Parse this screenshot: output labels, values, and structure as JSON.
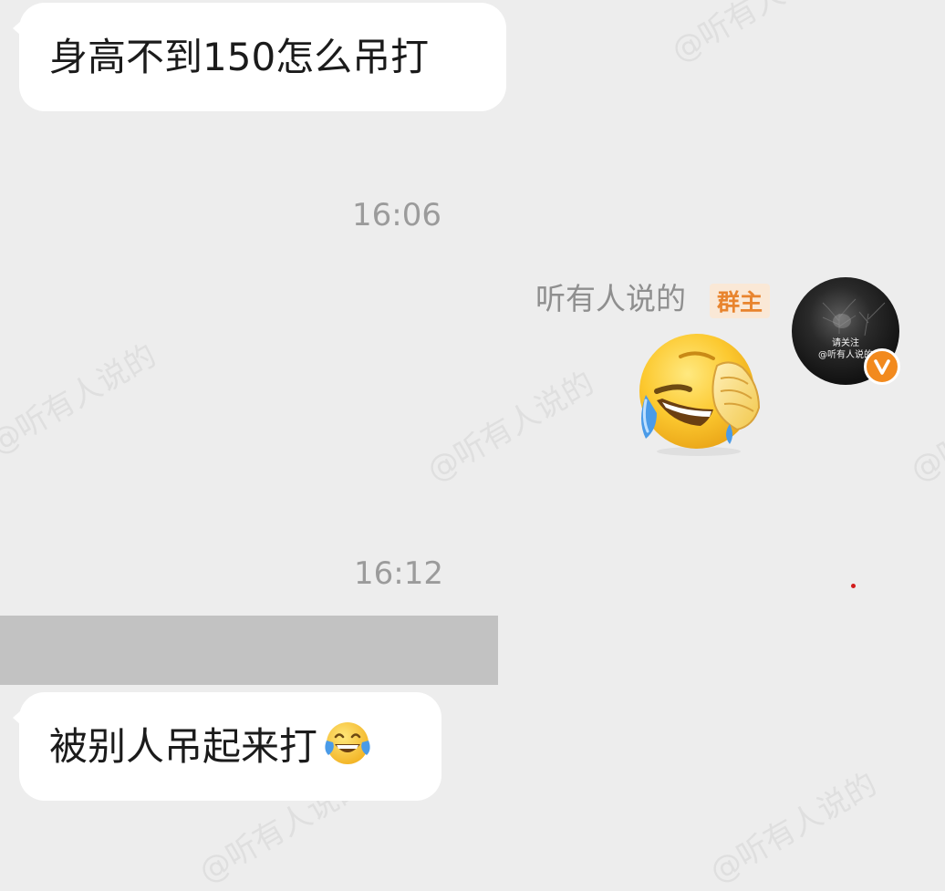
{
  "watermark": {
    "text": "@听有人说的"
  },
  "messages": [
    {
      "text": "身高不到150怎么吊打"
    },
    {
      "timestamp": "16:06"
    },
    {
      "sender_name": "听有人说的",
      "sender_role": "群主",
      "avatar_caption_1": "请关注",
      "avatar_caption_2": "@听有人说的",
      "emoji": "facepalm-laughing-emoji"
    },
    {
      "timestamp": "16:12"
    },
    {
      "redacted": true
    },
    {
      "text": "被别人吊起来打",
      "emoji": "tears-of-joy-emoji"
    }
  ],
  "colors": {
    "background": "#ededed",
    "bubble": "#ffffff",
    "timestamp": "#9b9b9b",
    "role_badge_text": "#e8842e",
    "role_badge_bg": "#fae8d6",
    "vip_badge": "#f28a1e",
    "redaction": "#c2c2c2"
  }
}
